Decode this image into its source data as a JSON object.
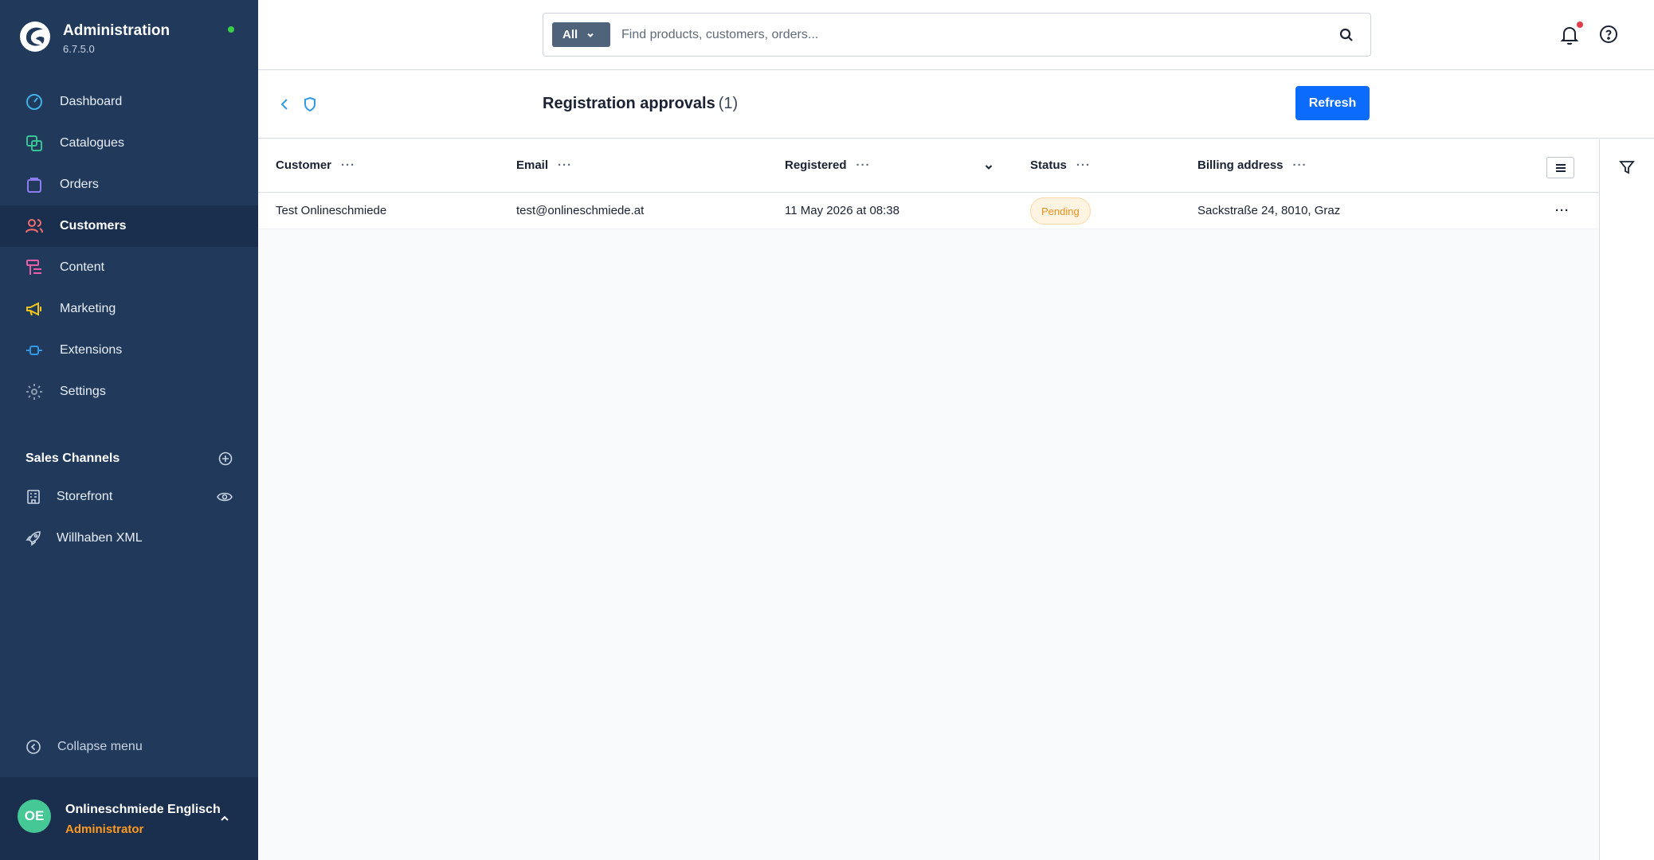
{
  "brand": {
    "title": "Administration",
    "version": "6.7.5.0"
  },
  "nav": {
    "items": [
      {
        "label": "Dashboard",
        "icon": "gauge-icon",
        "color": "#3fb0e8"
      },
      {
        "label": "Catalogues",
        "icon": "catalogue-icon",
        "color": "#37c494"
      },
      {
        "label": "Orders",
        "icon": "shopping-bag-icon",
        "color": "#8d7cf0"
      },
      {
        "label": "Customers",
        "icon": "users-icon",
        "color": "#f26d6d"
      },
      {
        "label": "Content",
        "icon": "content-icon",
        "color": "#e85fa8"
      },
      {
        "label": "Marketing",
        "icon": "megaphone-icon",
        "color": "#f5c518"
      },
      {
        "label": "Extensions",
        "icon": "plug-icon",
        "color": "#2f9be6"
      },
      {
        "label": "Settings",
        "icon": "gear-icon",
        "color": "#8a9bb0"
      }
    ],
    "active": "Customers"
  },
  "sales_channels": {
    "title": "Sales Channels",
    "items": [
      {
        "label": "Storefront",
        "icon": "storefront-icon"
      },
      {
        "label": "Willhaben XML",
        "icon": "rocket-icon"
      }
    ]
  },
  "collapse": {
    "label": "Collapse menu"
  },
  "user": {
    "initials": "OE",
    "name": "Onlineschmiede Englisch",
    "role": "Administrator"
  },
  "search": {
    "type": "All",
    "placeholder": "Find products, customers, orders..."
  },
  "page": {
    "title": "Registration approvals",
    "count": "(1)",
    "refresh_label": "Refresh"
  },
  "table": {
    "columns": [
      "Customer",
      "Email",
      "Registered",
      "Status",
      "Billing address"
    ],
    "column_dots": "···",
    "rows": [
      {
        "customer": "Test Onlineschmiede",
        "email": "test@onlineschmiede.at",
        "registered": "11 May 2026 at 08:38",
        "status": "Pending",
        "billing": "Sackstraße 24, 8010, Graz",
        "actions": "···"
      }
    ]
  },
  "colors": {
    "sidebar": "#213a5c",
    "sidebar_active": "#1a2f4d",
    "primary": "#0b6bfd",
    "pending": "#e8911a"
  }
}
